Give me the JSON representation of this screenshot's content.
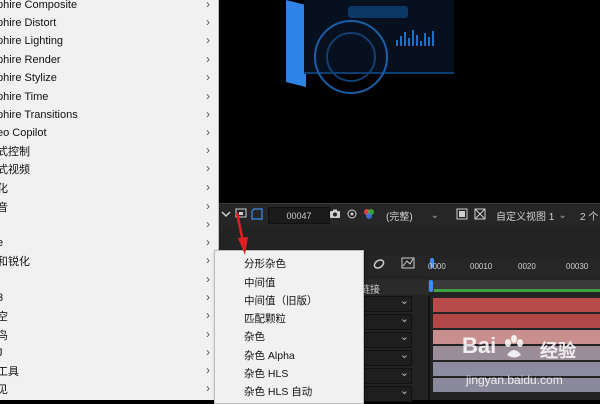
{
  "effects_menu": {
    "items": [
      {
        "label": "phire Composite"
      },
      {
        "label": "phire Distort"
      },
      {
        "label": "phire Lighting"
      },
      {
        "label": "phire Render"
      },
      {
        "label": "phire Stylize"
      },
      {
        "label": "phire Time"
      },
      {
        "label": "phire Transitions"
      },
      {
        "label": "eo Copilot"
      },
      {
        "label": "式控制"
      },
      {
        "label": "式视频"
      },
      {
        "label": "化"
      },
      {
        "label": "音"
      },
      {
        "label": "j"
      },
      {
        "label": "e"
      },
      {
        "label": "和锐化"
      },
      {
        "label": "l"
      },
      {
        "label": "3"
      },
      {
        "label": "空"
      },
      {
        "label": "鸟"
      },
      {
        "label": "J"
      },
      {
        "label": "工具"
      },
      {
        "label": "见"
      }
    ]
  },
  "submenu": {
    "items": [
      {
        "label": "分形杂色"
      },
      {
        "label": "中间值"
      },
      {
        "label": "中间值（旧版）"
      },
      {
        "label": "匹配颗粒"
      },
      {
        "label": "杂色"
      },
      {
        "label": "杂色 Alpha"
      },
      {
        "label": "杂色 HLS"
      },
      {
        "label": "杂色 HLS 自动"
      }
    ]
  },
  "viewer_toolbar": {
    "frame": "00047",
    "quality": "(完整)",
    "view": "自定义视图 1",
    "view_count": "2 个"
  },
  "timeline": {
    "ruler_ticks": [
      "0000",
      "00010",
      "0020",
      "00030"
    ],
    "column_header": "链接"
  },
  "watermark": {
    "brand": "Bai",
    "brand_suffix": "经验",
    "url": "jingyan.baidu.com"
  },
  "colors": {
    "accent_blue": "#3d8cf0",
    "arrow_red": "#e02020",
    "track_green": "#3ea33e"
  }
}
